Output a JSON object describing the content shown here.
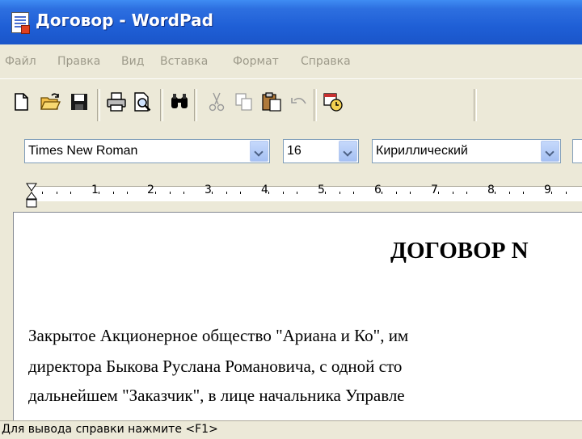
{
  "window": {
    "title": "Договор - WordPad"
  },
  "menu": {
    "items": [
      "Файл",
      "Правка",
      "Вид",
      "Вставка",
      "Формат",
      "Справка"
    ]
  },
  "toolbar": {
    "icons": [
      "new-document-icon",
      "open-folder-icon",
      "save-icon",
      "print-icon",
      "print-preview-icon",
      "find-icon",
      "cut-icon",
      "copy-icon",
      "paste-icon",
      "undo-icon",
      "insert-datetime-icon"
    ]
  },
  "format": {
    "font_name": "Times New Roman",
    "font_size": "16",
    "script": "Кириллический"
  },
  "ruler": {
    "numbers": [
      "1",
      "2",
      "3",
      "4",
      "5",
      "6",
      "7",
      "8",
      "9"
    ]
  },
  "document": {
    "title": "ДОГОВОР N",
    "lines": [
      "Закрытое Акционерное общество \"Ариана и Ко\", им",
      "директора Быкова Руслана Романовича, с одной сто",
      "дальнейшем \"Заказчик\", в лице начальника Управле"
    ]
  },
  "status": {
    "text": "Для вывода справки нажмите <F1>"
  },
  "colors": {
    "titlebar": "#2d6fe0",
    "menu_text_disabled": "#9d9a8a",
    "window_bg": "#ece9d8"
  }
}
